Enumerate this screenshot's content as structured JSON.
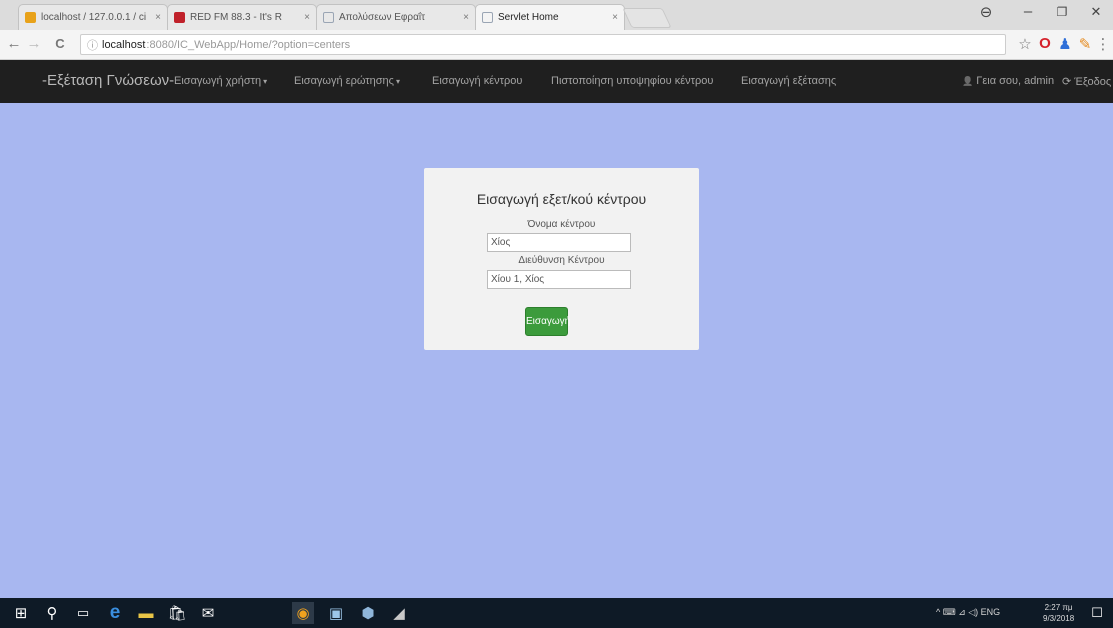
{
  "browser": {
    "tabs": [
      {
        "title": "localhost / 127.0.0.1 / ci",
        "color": "#e8a21a"
      },
      {
        "title": "RED FM 88.3 - It's R",
        "color": "#c0212a"
      },
      {
        "title": "Απολύσεων Εφραΐτ",
        "color": "#9aa5b4"
      },
      {
        "title": "Servlet Home",
        "color": "#9aa5b4"
      }
    ],
    "tab_close": "×",
    "window_controls": {
      "minimize": "–",
      "maximize": "❐",
      "close": "✕",
      "profile": "⊖"
    },
    "nav": {
      "back": "←",
      "forward": "→",
      "reload": "C"
    },
    "address": {
      "info": "ⓘ",
      "host": "localhost",
      "path": ":8080/IC_WebApp/Home/?option=centers"
    },
    "toolbar_icons": {
      "star": "☆",
      "opera": "O",
      "ext1": "♟",
      "ext2": "✎",
      "menu": "⋮"
    }
  },
  "app": {
    "brand": "-Εξέταση Γνώσεων-",
    "menu": [
      {
        "label": "Εισαγωγή χρήστη",
        "caret": "▾"
      },
      {
        "label": "Εισαγωγή ερώτησης",
        "caret": "▾"
      },
      {
        "label": "Εισαγωγή κέντρου",
        "caret": ""
      },
      {
        "label": "Πιστοποίηση υποψηφίου κέντρου",
        "caret": ""
      },
      {
        "label": "Εισαγωγή εξέτασης",
        "caret": ""
      }
    ],
    "user_icon": "👤",
    "greeting": "Γεια σου, admin",
    "logout_icon": "⟳",
    "logout": "Έξοδος"
  },
  "form": {
    "title": "Εισαγωγή εξετ/κού κέντρου",
    "name_label": "Όνομα κέντρου",
    "name_value": "Χίος",
    "address_label": "Διεύθυνση Κέντρου",
    "address_value": "Χίου 1, Χίος",
    "submit": "Εισαγωγή"
  },
  "taskbar": {
    "start": "⊞",
    "search": "⚲",
    "taskview": "▭",
    "apps": [
      "e",
      "▬",
      "🛍",
      "✉",
      "◉",
      "▣",
      "⬢",
      "◢"
    ],
    "tray": "^  ⌨  ⊿  ◁)  ENG",
    "time": "2:27 πμ",
    "date": "9/3/2018",
    "notifications": "☐"
  }
}
